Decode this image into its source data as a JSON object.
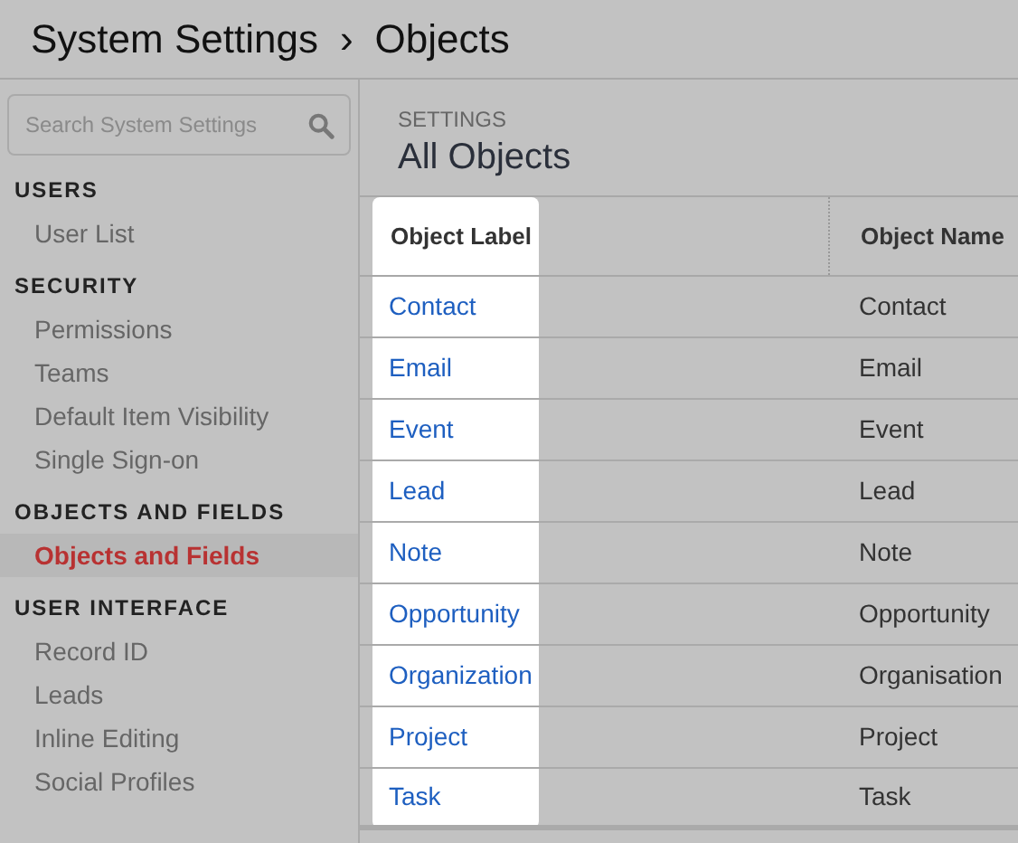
{
  "header": {
    "title": "System Settings",
    "separator": "›",
    "subtitle": "Objects"
  },
  "sidebar": {
    "search": {
      "placeholder": "Search System Settings"
    },
    "sections": [
      {
        "heading": "USERS",
        "items": [
          {
            "label": "User List",
            "selected": false
          }
        ]
      },
      {
        "heading": "SECURITY",
        "items": [
          {
            "label": "Permissions",
            "selected": false
          },
          {
            "label": "Teams",
            "selected": false
          },
          {
            "label": "Default Item Visibility",
            "selected": false
          },
          {
            "label": "Single Sign-on",
            "selected": false
          }
        ]
      },
      {
        "heading": "OBJECTS AND FIELDS",
        "items": [
          {
            "label": "Objects and Fields",
            "selected": true
          }
        ]
      },
      {
        "heading": "USER INTERFACE",
        "items": [
          {
            "label": "Record ID",
            "selected": false
          },
          {
            "label": "Leads",
            "selected": false
          },
          {
            "label": "Inline Editing",
            "selected": false
          },
          {
            "label": "Social Profiles",
            "selected": false
          }
        ]
      }
    ]
  },
  "main": {
    "eyebrow": "SETTINGS",
    "title": "All Objects",
    "table": {
      "columns": [
        "Object Label",
        "Object Name"
      ],
      "rows": [
        [
          "Contact",
          "Contact"
        ],
        [
          "Email",
          "Email"
        ],
        [
          "Event",
          "Event"
        ],
        [
          "Lead",
          "Lead"
        ],
        [
          "Note",
          "Note"
        ],
        [
          "Opportunity",
          "Opportunity"
        ],
        [
          "Organization",
          "Organisation"
        ],
        [
          "Project",
          "Project"
        ],
        [
          "Task",
          "Task"
        ]
      ]
    }
  }
}
